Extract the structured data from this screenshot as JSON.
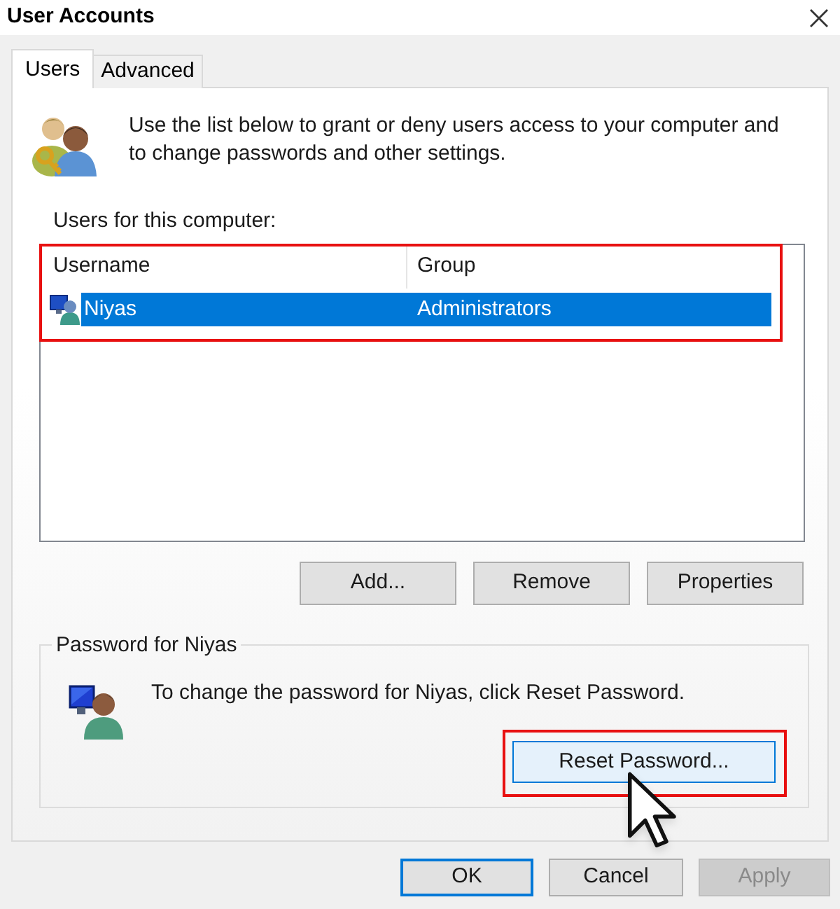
{
  "window": {
    "title": "User Accounts"
  },
  "tabs": [
    {
      "label": "Users",
      "selected": true
    },
    {
      "label": "Advanced",
      "selected": false
    }
  ],
  "intro": {
    "text": "Use the list below to grant or deny users access to your computer and to change passwords and other settings."
  },
  "user_list": {
    "label": "Users for this computer:",
    "highlighted": true,
    "columns": [
      "Username",
      "Group"
    ],
    "rows": [
      {
        "username": "Niyas",
        "group": "Administrators",
        "selected": true
      }
    ]
  },
  "list_buttons": [
    {
      "label": "Add..."
    },
    {
      "label": "Remove"
    },
    {
      "label": "Properties"
    }
  ],
  "password_group": {
    "title": "Password for Niyas",
    "text": "To change the password for Niyas, click Reset Password.",
    "button": {
      "label": "Reset Password...",
      "hovered": true,
      "highlighted": true
    }
  },
  "dialog_buttons": [
    {
      "label": "OK",
      "default": true,
      "disabled": false
    },
    {
      "label": "Cancel",
      "default": false,
      "disabled": false
    },
    {
      "label": "Apply",
      "default": false,
      "disabled": true
    }
  ]
}
